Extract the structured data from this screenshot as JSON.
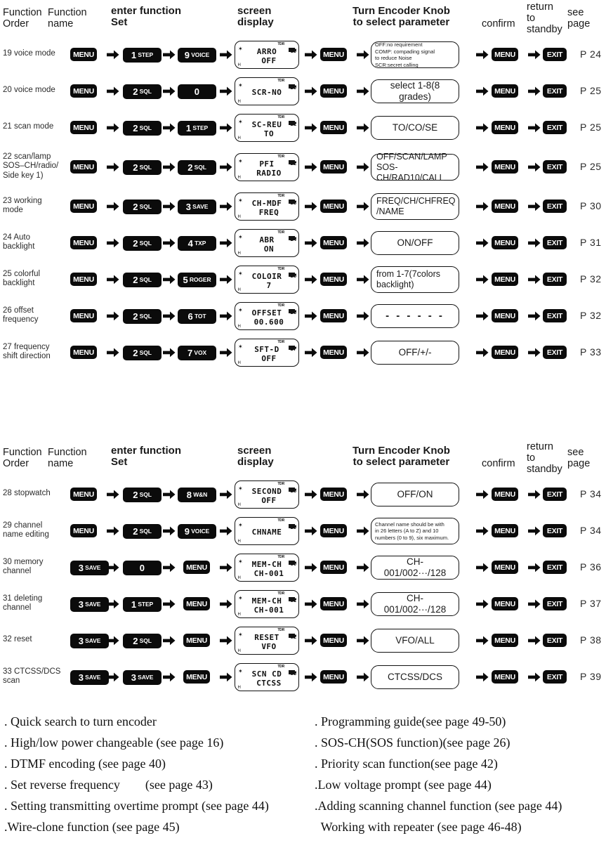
{
  "columns": {
    "function_order": "Function\nOrder",
    "function_name": "Function\nname",
    "enter_function_set": "enter function\nSet",
    "screen_display": "screen\ndisplay",
    "turn_encoder": "Turn Encoder Knob\nto select parameter",
    "confirm": "confirm",
    "return_to_standby": "return\nto\nstandby",
    "see_page": "see\npage"
  },
  "header_parts": {
    "function_order_l1": "Function",
    "function_order_l2": "Order",
    "function_name_l1": "Function",
    "function_name_l2": "name",
    "enter_l1": "enter function",
    "enter_l2": "Set",
    "screen_l1": "screen",
    "screen_l2": "display",
    "encoder_l1": "Turn Encoder Knob",
    "encoder_l2": "to select parameter",
    "confirm": "confirm",
    "return_l1": "return",
    "return_l2": "to",
    "return_l3": "standby",
    "page_l1": "see",
    "page_l2": "page"
  },
  "keys": {
    "menu": "MENU",
    "exit": "EXIT",
    "k0": {
      "num": "0",
      "sub": ""
    },
    "k1": {
      "num": "1",
      "sub": "STEP"
    },
    "k2": {
      "num": "2",
      "sub": "SQL"
    },
    "k3": {
      "num": "3",
      "sub": "SAVE"
    },
    "k4": {
      "num": "4",
      "sub": "TXP"
    },
    "k5": {
      "num": "5",
      "sub": "ROGER"
    },
    "k6": {
      "num": "6",
      "sub": "TOT"
    },
    "k7": {
      "num": "7",
      "sub": "VOX"
    },
    "k8": {
      "num": "8",
      "sub": "W&N"
    },
    "k9": {
      "num": "9",
      "sub": "VOICE"
    }
  },
  "lcd_common": {
    "tdr": "TDR",
    "dot": "✶",
    "hmark": "H"
  },
  "table1": {
    "rows": [
      {
        "name": "19 voice mode",
        "steps": [
          "MENU",
          "1 STEP",
          "9 VOICE"
        ],
        "lcd": {
          "line1": "ARRO",
          "line2": "OFF",
          "index": "19"
        },
        "param": "OFF:no requirement\nCOMP: compading signal\nto reduce Noise\nSCR:secret calling",
        "param_style": "small",
        "page": "P 24"
      },
      {
        "name": "20 voice mode",
        "steps": [
          "MENU",
          "2 SQL",
          "0"
        ],
        "lcd": {
          "line1": "SCR-NO",
          "line2": "",
          "index": "20"
        },
        "param": "select 1-8(8 grades)",
        "param_style": "normal",
        "page": "P 25"
      },
      {
        "name": "21 scan mode",
        "steps": [
          "MENU",
          "2 SQL",
          "1 STEP"
        ],
        "lcd": {
          "line1": "SC-REU",
          "line2": "TO",
          "index": "21"
        },
        "param": "TO/CO/SE",
        "param_style": "normal",
        "page": "P 25"
      },
      {
        "name": "22 scan/lamp\nSOS–CH/radio/\nSide key 1)",
        "steps": [
          "MENU",
          "2 SQL",
          "2 SQL"
        ],
        "lcd": {
          "line1": "PFI",
          "line2": "RADIO",
          "index": "22"
        },
        "param": "OFF/SCAN/LAMP\nSOS-CH/RAD10/CALL",
        "param_style": "left",
        "page": "P 25"
      },
      {
        "name": "23 working\nmode",
        "steps": [
          "MENU",
          "2 SQL",
          "3 SAVE"
        ],
        "lcd": {
          "line1": "CH-MDF",
          "line2": "FREQ",
          "index": "23"
        },
        "param": "FREQ/CH/CHFREQ\n/NAME",
        "param_style": "left",
        "page": "P 30"
      },
      {
        "name": "24 Auto\nbacklight",
        "steps": [
          "MENU",
          "2 SQL",
          "4 TXP"
        ],
        "lcd": {
          "line1": "ABR",
          "line2": "ON",
          "index": "24"
        },
        "param": "ON/OFF",
        "param_style": "normal",
        "page": "P 31"
      },
      {
        "name": "25 colorful\nbacklight",
        "steps": [
          "MENU",
          "2 SQL",
          "5 ROGER"
        ],
        "lcd": {
          "line1": "COLOIR",
          "line2": "7",
          "index": "25"
        },
        "param": "from 1-7(7colors\nbacklight)",
        "param_style": "left",
        "page": "P 32"
      },
      {
        "name": "26 offset\nfrequency",
        "steps": [
          "MENU",
          "2 SQL",
          "6 TOT"
        ],
        "lcd": {
          "line1": "OFFSET",
          "line2": "00.600",
          "index": "26"
        },
        "param": "- - - - - -",
        "param_style": "dash",
        "page": "P 32"
      },
      {
        "name": "27 frequency\nshift direction",
        "steps": [
          "MENU",
          "2 SQL",
          "7 VOX"
        ],
        "lcd": {
          "line1": "SFT-D",
          "line2": "OFF",
          "index": "27"
        },
        "param": "OFF/+/-",
        "param_style": "normal",
        "page": "P 33"
      }
    ]
  },
  "table2": {
    "rows": [
      {
        "name": "28 stopwatch",
        "steps": [
          "MENU",
          "2 SQL",
          "8 W&N"
        ],
        "lcd": {
          "line1": "SECOND",
          "line2": "OFF",
          "index": "28"
        },
        "param": "OFF/ON",
        "param_style": "normal",
        "page": "P 34"
      },
      {
        "name": "29 channel\nname editing",
        "steps": [
          "MENU",
          "2 SQL",
          "9 VOICE"
        ],
        "lcd": {
          "line1": "CHNAME",
          "line2": "",
          "index": "29"
        },
        "param": "Channel name should be with\nin 26 letters (A to Z) and 10\nnumbers (0 to 9), six maximum.",
        "param_style": "small",
        "page": "P 34"
      },
      {
        "name": "30 memory\nchannel",
        "steps": [
          "3 SAVE",
          "0",
          "MENU"
        ],
        "lcd": {
          "line1": "MEM-CH",
          "line2": "CH-001",
          "index": "30"
        },
        "param": "CH-001/002···/128",
        "param_style": "normal",
        "page": "P 36"
      },
      {
        "name": "31 deleting\nchannel",
        "steps": [
          "3 SAVE",
          "1 STEP",
          "MENU"
        ],
        "lcd": {
          "line1": "MEM-CH",
          "line2": "CH-001",
          "index": "31"
        },
        "param": "CH-001/002···/128",
        "param_style": "normal",
        "page": "P 37"
      },
      {
        "name": "32 reset",
        "steps": [
          "3 SAVE",
          "2 SQL",
          "MENU"
        ],
        "lcd": {
          "line1": "RESET",
          "line2": "VFO",
          "index": "32"
        },
        "param": "VFO/ALL",
        "param_style": "normal",
        "page": "P 38"
      },
      {
        "name": "33 CTCSS/DCS\nscan",
        "steps": [
          "3 SAVE",
          "3 SAVE",
          "MENU"
        ],
        "lcd": {
          "line1": "SCN CD",
          "line2": "CTCSS",
          "index": "33"
        },
        "param": "CTCSS/DCS",
        "param_style": "normal",
        "page": "P 39"
      }
    ]
  },
  "footer": {
    "left": [
      ". Quick search to turn encoder",
      ". High/low power changeable (see page 16)",
      ". DTMF encoding (see page 40)",
      ". Set reverse frequency        (see page 43)",
      ". Setting transmitting overtime prompt (see page 44)",
      ".Wire-clone function (see page 45)"
    ],
    "right": [
      ". Programming guide(see page 49-50)",
      ". SOS-CH(SOS function)(see page 26)",
      ". Priority scan function(see page 42)",
      ".Low voltage prompt (see page 44)",
      ".Adding scanning channel function (see page 44)",
      "  Working with repeater (see page 46-48)"
    ]
  }
}
